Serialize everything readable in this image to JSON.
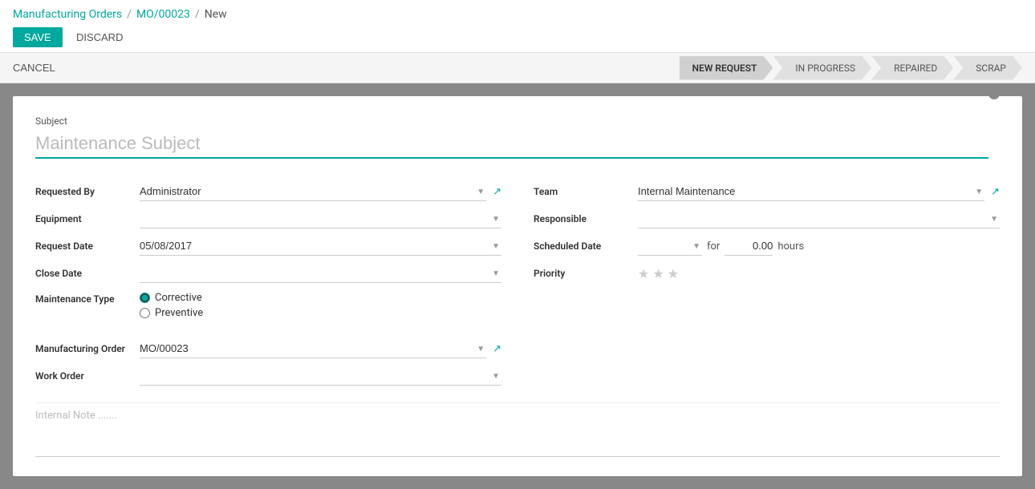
{
  "breadcrumb": {
    "link1": "Manufacturing Orders",
    "sep1": "/",
    "link2": "MO/00023",
    "sep2": "/",
    "current": "New"
  },
  "toolbar": {
    "save_label": "SAVE",
    "discard_label": "DISCARD"
  },
  "statusbar": {
    "cancel_label": "CANCEL",
    "steps": [
      {
        "label": "NEW REQUEST",
        "active": true
      },
      {
        "label": "IN PROGRESS",
        "active": false
      },
      {
        "label": "REPAIRED",
        "active": false
      },
      {
        "label": "SCRAP",
        "active": false
      }
    ]
  },
  "form": {
    "subject_label": "Subject",
    "subject_placeholder": "Maintenance Subject",
    "status_dot": "",
    "left": {
      "requested_by_label": "Requested By",
      "requested_by_value": "Administrator",
      "equipment_label": "Equipment",
      "equipment_value": "",
      "request_date_label": "Request Date",
      "request_date_value": "05/08/2017",
      "close_date_label": "Close Date",
      "close_date_value": "",
      "maintenance_type_label": "Maintenance Type",
      "maintenance_type_corrective": "Corrective",
      "maintenance_type_preventive": "Preventive",
      "manufacturing_order_label": "Manufacturing Order",
      "manufacturing_order_value": "MO/00023",
      "work_order_label": "Work Order",
      "work_order_value": ""
    },
    "right": {
      "team_label": "Team",
      "team_value": "Internal Maintenance",
      "responsible_label": "Responsible",
      "responsible_value": "",
      "scheduled_date_label": "Scheduled Date",
      "scheduled_date_value": "",
      "for_label": "for",
      "hours_value": "0.00",
      "hours_label": "hours",
      "priority_label": "Priority"
    },
    "internal_note_placeholder": "Internal Note ......."
  }
}
